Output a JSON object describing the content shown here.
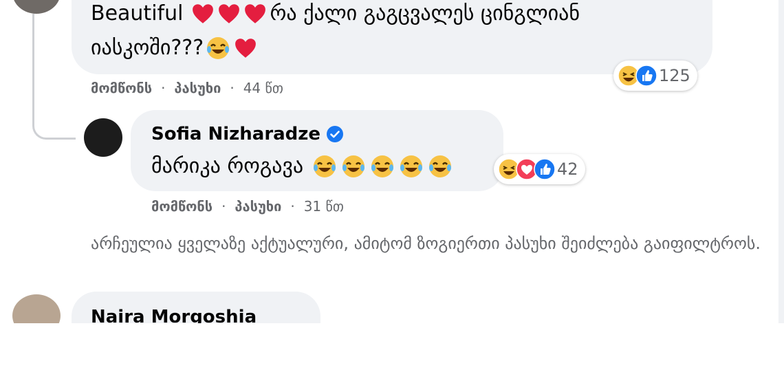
{
  "comments": [
    {
      "text_line1": "Beautiful",
      "text_line1_rest": "რა ქალი გაგცვალეს ცინგლიან",
      "text_line2": "იასკოში???",
      "actions": {
        "like": "მომწონს",
        "reply": "პასუხი",
        "time": "44 წთ"
      },
      "reactions": {
        "icons": [
          "haha-icon",
          "like-icon"
        ],
        "count": "125"
      }
    },
    {
      "author": "Sofia Nizharadze",
      "verified": true,
      "text": "მარიკა როგავა",
      "actions": {
        "like": "მომწონს",
        "reply": "პასუხი",
        "time": "31 წთ"
      },
      "reactions": {
        "icons": [
          "haha-icon",
          "love-icon",
          "like-icon"
        ],
        "count": "42"
      }
    },
    {
      "author": "Naira Morgoshia"
    }
  ],
  "filter_note": "არჩეულია ყველაზე აქტუალური, ამიტომ ზოგიერთი პასუხი შეიძლება გაიფილტროს.",
  "separator": "·",
  "colors": {
    "bubble": "#f0f2f5",
    "meta_text": "#65676b",
    "heart": "#e41e3f",
    "like_blue": "#1877f2",
    "haha_yellow": "#f7c244"
  }
}
